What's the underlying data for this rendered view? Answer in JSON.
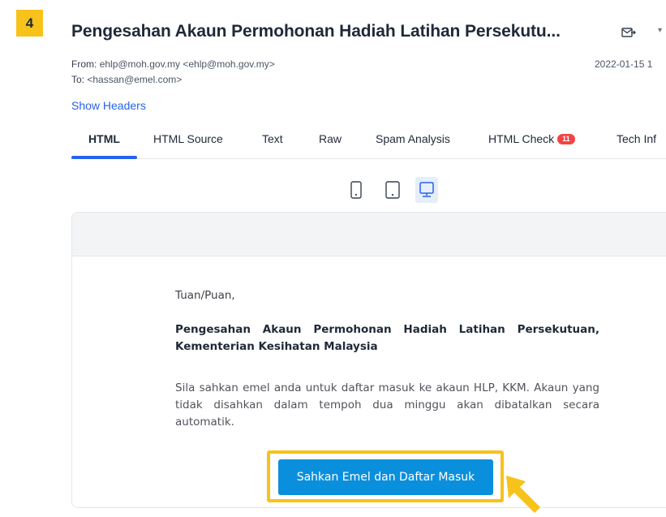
{
  "step": {
    "number": "4"
  },
  "email": {
    "subject": "Pengesahan Akaun Permohonan Hadiah Latihan Persekutu...",
    "from_label": "From:",
    "from_value": "ehlp@moh.gov.my <ehlp@moh.gov.my>",
    "to_label": "To:",
    "to_value": "<hassan@emel.com>",
    "date": "2022-01-15 1",
    "show_headers": "Show Headers"
  },
  "tabs": [
    {
      "label": "HTML",
      "active": true
    },
    {
      "label": "HTML Source"
    },
    {
      "label": "Text"
    },
    {
      "label": "Raw"
    },
    {
      "label": "Spam Analysis"
    },
    {
      "label": "HTML Check",
      "badge": "11"
    },
    {
      "label": "Tech Inf"
    }
  ],
  "device_toggle": {
    "options": [
      "mobile-icon",
      "tablet-icon",
      "desktop-icon"
    ],
    "selected": "desktop-icon"
  },
  "preview": {
    "greeting": "Tuan/Puan,",
    "title": "Pengesahan Akaun Permohonan Hadiah Latihan Persekutuan, Kementerian Kesihatan Malaysia",
    "paragraph": "Sila sahkan emel anda untuk daftar masuk ke akaun HLP, KKM. Akaun yang tidak disahkan dalam tempoh dua minggu akan dibatalkan secara automatik.",
    "button_label": "Sahkan Emel dan Daftar Masuk"
  },
  "colors": {
    "accent_blue": "#2563eb",
    "button_blue": "#0a8fdc",
    "highlight_yellow": "#f7c21a",
    "badge_red": "#ef4444"
  }
}
